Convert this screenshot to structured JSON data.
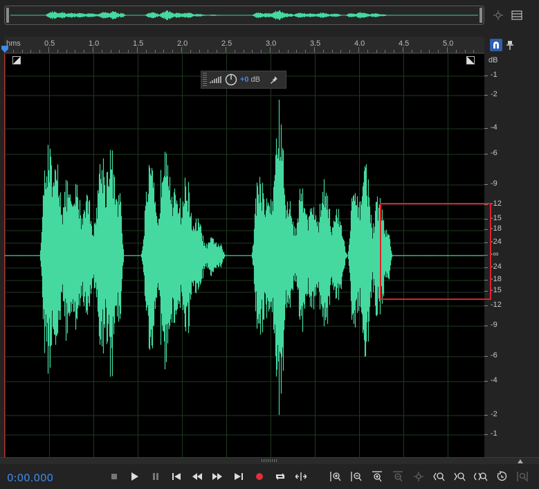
{
  "ruler": {
    "unit_label": "hms",
    "ticks": [
      "0.5",
      "1.0",
      "1.5",
      "2.0",
      "2.5",
      "3.0",
      "3.5",
      "4.0",
      "4.5",
      "5.0"
    ]
  },
  "hud": {
    "value": "+0",
    "unit": "dB"
  },
  "db_scale": {
    "header": "dB",
    "labels": [
      "-1",
      "-2",
      "-4",
      "-6",
      "-9",
      "-12",
      "-15",
      "-18",
      "-24",
      "-∞",
      "-24",
      "-18",
      "-15",
      "-12",
      "-9",
      "-6",
      "-4",
      "-2",
      "-1"
    ]
  },
  "transport": {
    "time": "0:00.000"
  },
  "colors": {
    "waveform": "#45d9a0",
    "time_text": "#3d8ae8",
    "highlight": "#e0202a",
    "record": "#e0303a"
  },
  "icons": {
    "overview_right": [
      "zoom-navigator-icon",
      "menu-list-icon"
    ],
    "ruler_right": [
      "snap-magnet-icon",
      "pin-icon"
    ],
    "transport": [
      "stop-icon",
      "play-icon",
      "pause-icon",
      "skip-to-start-icon",
      "rewind-icon",
      "fast-forward-icon",
      "skip-to-end-icon",
      "record-icon",
      "loop-icon",
      "skip-selection-icon"
    ],
    "zoom": [
      "zoom-in-amplitude-icon",
      "zoom-out-amplitude-icon",
      "zoom-in-time-icon",
      "zoom-out-time-icon",
      "zoom-selection-icon",
      "zoom-in-point-icon",
      "zoom-out-point-icon",
      "zoom-full-icon",
      "zoom-reset-icon",
      "zoom-fit-icon"
    ]
  }
}
